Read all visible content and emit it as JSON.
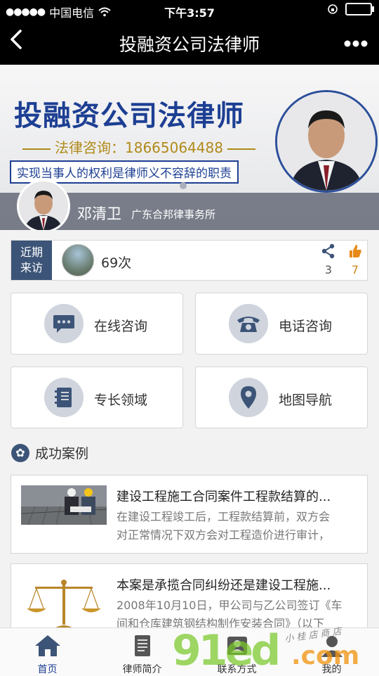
{
  "status_bar": {
    "signal": "●●●●●",
    "carrier": "中国电信",
    "time": "下午3:57"
  },
  "nav": {
    "back_icon": "chevron-left",
    "title": "投融资公司法律师",
    "more_icon": "ellipsis"
  },
  "banner": {
    "title": "投融资公司法律师",
    "phone": "法律咨询：18665064488",
    "slogan": "实现当事人的权利是律师义不容辞的职责",
    "name": "邓清卫",
    "firm": "广东合邦律事务所"
  },
  "visits": {
    "tag_line1": "近期",
    "tag_line2": "来访",
    "count": "69次",
    "share_count": "3",
    "like_count": "7"
  },
  "services": [
    {
      "label": "在线咨询",
      "icon": "chat-icon"
    },
    {
      "label": "电话咨询",
      "icon": "phone-icon"
    },
    {
      "label": "专长领域",
      "icon": "notebook-icon"
    },
    {
      "label": "地图导航",
      "icon": "map-pin-icon"
    }
  ],
  "section": {
    "title": "成功案例"
  },
  "cases": [
    {
      "title": "建设工程施工合同案件工程款结算的...",
      "desc_line1": "在建设工程竣工后，工程款结算前，双方会",
      "desc_line2": "对正常情况下双方会对工程造价进行审计，"
    },
    {
      "title": "本案是承揽合同纠纷还是建设工程施...",
      "desc_line1": "2008年10月10日，甲公司与乙公司签订《车",
      "desc_line2": "间和仓库建筑钢结构制作安装合同》（以下"
    }
  ],
  "tabs": [
    {
      "label": "首页",
      "icon": "home-icon"
    },
    {
      "label": "律师简介",
      "icon": "profile-card-icon"
    },
    {
      "label": "联系方式",
      "icon": "contact-icon"
    },
    {
      "label": "我的",
      "icon": "user-icon"
    }
  ],
  "watermark": {
    "main": "91ed",
    "suffix": ".com",
    "shop": "小 桂 店 商 店"
  },
  "colors": {
    "accent": "#3c5477",
    "brand_blue": "#1d3f93",
    "like": "#c98a1b"
  }
}
